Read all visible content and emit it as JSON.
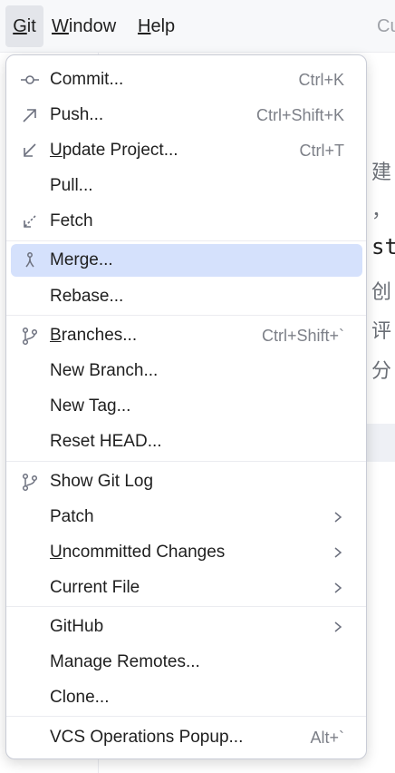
{
  "menubar": {
    "git": "Git",
    "window": "Window",
    "help": "Help",
    "right_fragment": "Cu"
  },
  "background": {
    "line1": "建",
    "line2": "，",
    "line3": "st",
    "line4": "创",
    "line5": "评",
    "line6": "分"
  },
  "menu": {
    "commit": {
      "label": "Commit...",
      "shortcut": "Ctrl+K",
      "icon": "commit-icon"
    },
    "push": {
      "label": "Push...",
      "shortcut": "Ctrl+Shift+K",
      "icon": "push-arrow-icon"
    },
    "update_project": {
      "label": "Update Project...",
      "shortcut": "Ctrl+T",
      "icon": "update-arrow-icon"
    },
    "pull": {
      "label": "Pull..."
    },
    "fetch": {
      "label": "Fetch",
      "icon": "fetch-icon"
    },
    "merge": {
      "label": "Merge...",
      "icon": "merge-icon"
    },
    "rebase": {
      "label": "Rebase..."
    },
    "branches": {
      "label": "Branches...",
      "shortcut": "Ctrl+Shift+`",
      "icon": "branch-icon"
    },
    "new_branch": {
      "label": "New Branch..."
    },
    "new_tag": {
      "label": "New Tag..."
    },
    "reset_head": {
      "label": "Reset HEAD..."
    },
    "show_git_log": {
      "label": "Show Git Log",
      "icon": "branch-icon"
    },
    "patch": {
      "label": "Patch"
    },
    "uncommitted_changes": {
      "label": "Uncommitted Changes"
    },
    "current_file": {
      "label": "Current File"
    },
    "github": {
      "label": "GitHub"
    },
    "manage_remotes": {
      "label": "Manage Remotes..."
    },
    "clone": {
      "label": "Clone..."
    },
    "vcs_operations_popup": {
      "label": "VCS Operations Popup...",
      "shortcut": "Alt+`"
    }
  },
  "colors": {
    "selected_row": "#d5e1fc",
    "menubar_bg": "#f7f8fa",
    "shortcut_text": "#7d8088"
  }
}
